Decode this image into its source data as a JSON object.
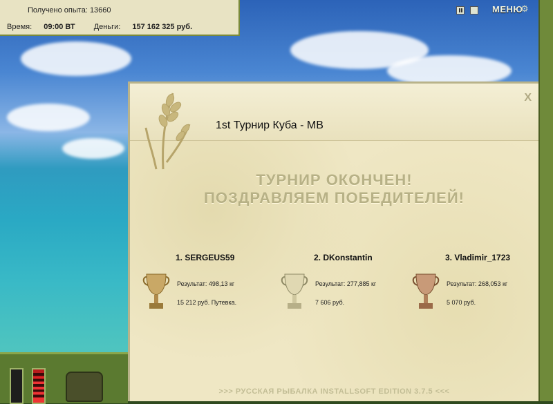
{
  "hud": {
    "exp_label": "Получено опыта:",
    "exp_value": "13660",
    "time_label": "Время:",
    "time_value": "09:00 ВТ",
    "money_label": "Деньги:",
    "money_value": "157 162 325 руб."
  },
  "topright": {
    "pause_label": "II",
    "save_label": "S",
    "menu_label": "МЕНЮ"
  },
  "dialog": {
    "close_label": "X",
    "title": "1st Турнир Куба - МВ",
    "banner_line1": "ТУРНИР ОКОНЧЕН!",
    "banner_line2": "ПОЗДРАВЛЯЕМ ПОБЕДИТЕЛЕЙ!",
    "winners": [
      {
        "name": "1. SERGEUS59",
        "result": "Результат: 498,13 кг",
        "prize": "15 212 руб. Путевка.",
        "cup_color": "#c9a866"
      },
      {
        "name": "2. DKonstantin",
        "result": "Результат: 277,885 кг",
        "prize": "7 606 руб.",
        "cup_color": "#d8d0a8"
      },
      {
        "name": "3. Vladimir_1723",
        "result": "Результат: 268,053 кг",
        "prize": "5 070 руб.",
        "cup_color": "#c89a78"
      }
    ],
    "footer": ">>> РУССКАЯ РЫБАЛКА INSTALLSOFT EDITION 3.7.5 <<<"
  }
}
